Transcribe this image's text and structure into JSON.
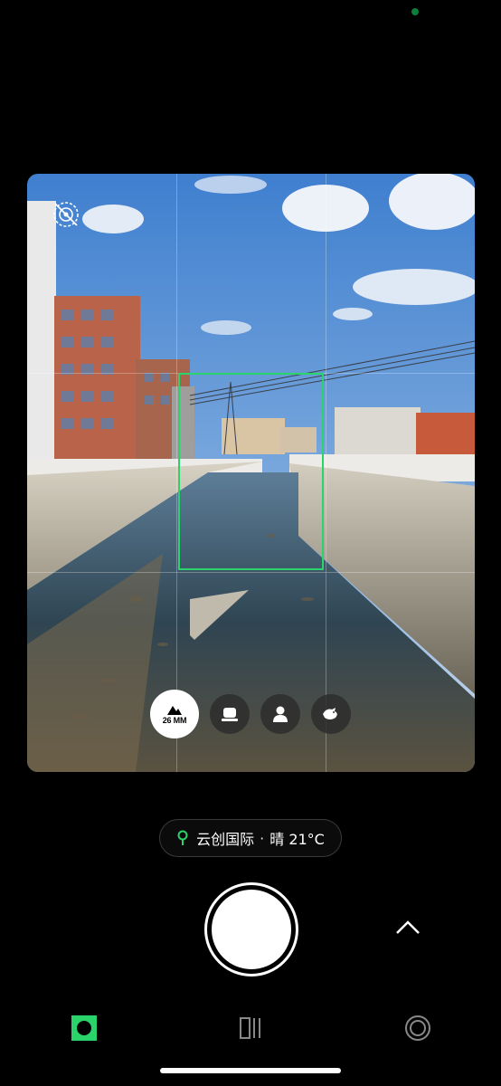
{
  "viewfinder": {
    "lenses": [
      {
        "id": "landscape",
        "label": "26 MM",
        "active": true,
        "icon": "mountain-icon"
      },
      {
        "id": "food",
        "label": "",
        "active": false,
        "icon": "food-icon"
      },
      {
        "id": "portrait",
        "label": "",
        "active": false,
        "icon": "person-icon"
      },
      {
        "id": "animal",
        "label": "",
        "active": false,
        "icon": "bird-icon"
      }
    ],
    "focus_color": "#2bd46b",
    "top_left_icon": "ai-off-icon"
  },
  "location": {
    "place": "云创国际",
    "separator": "·",
    "weather": "晴 21°C",
    "pin_color": "#2bd46b"
  },
  "bottom_nav": [
    {
      "name": "photo-mode",
      "icon": "square-dot-icon",
      "active": true,
      "color": "#2bd46b"
    },
    {
      "name": "gallery-mode",
      "icon": "stack-icon",
      "active": false
    },
    {
      "name": "lens-mode",
      "icon": "ring-icon",
      "active": false
    }
  ]
}
